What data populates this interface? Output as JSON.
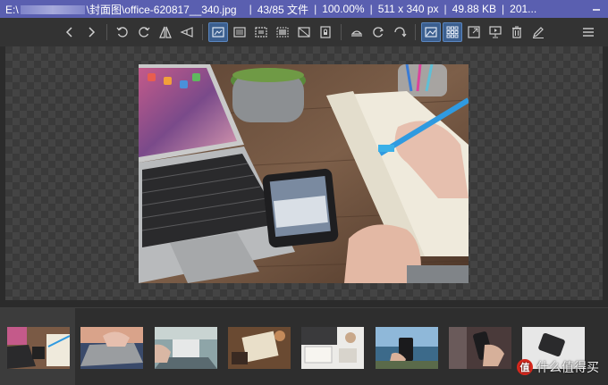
{
  "titlebar": {
    "path_prefix": "E:\\",
    "path_suffix": "\\封面图\\office-620817__340.jpg",
    "index": "43/85 文件",
    "zoom": "100.00%",
    "dimensions": "511 x 340 px",
    "filesize": "49.88 KB",
    "date": "201..."
  },
  "toolbar": {
    "icons": [
      "chevron-left-icon",
      "chevron-right-icon",
      "rotate-left-icon",
      "rotate-right-icon",
      "flip-horizontal-icon",
      "flip-vertical-icon",
      "fit-window-icon",
      "fit-width-icon",
      "actual-size-icon",
      "fill-icon",
      "crop-icon",
      "lock-icon",
      "adjust-icon",
      "refresh-icon",
      "redo-icon",
      "image-view-icon",
      "grid-view-icon",
      "fullscreen-icon",
      "slideshow-icon",
      "trash-icon",
      "edit-icon",
      "menu-icon"
    ]
  },
  "watermark": {
    "badge": "值",
    "text": "什么值得买"
  },
  "colors": {
    "titlebar": "#5a5fb0",
    "toolbar": "#333333",
    "active_button": "#3b5f8f",
    "background": "#2b2b2b"
  }
}
